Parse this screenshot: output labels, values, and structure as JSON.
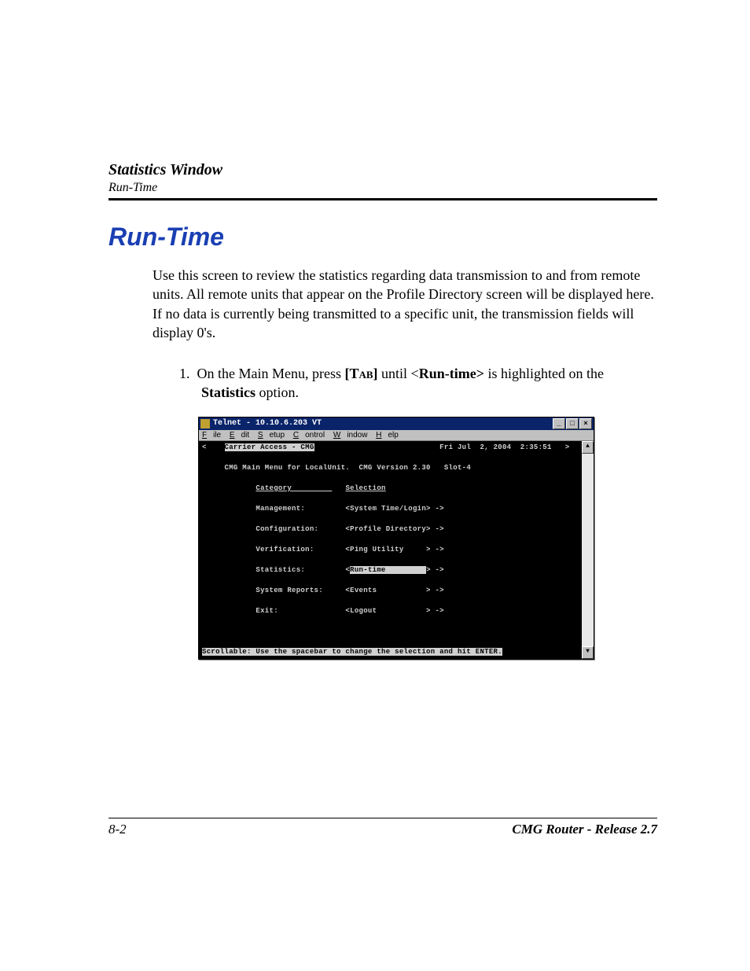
{
  "header": {
    "section_title": "Statistics Window",
    "subtitle": "Run-Time"
  },
  "main_heading": "Run-Time",
  "intro_paragraph": "Use this screen to review the statistics regarding data transmission to and from remote units. All remote units that appear on the Profile Directory screen will be displayed here. If no data is currently being transmitted to a specific unit, the transmission fields will display 0's.",
  "step": {
    "number": "1.",
    "pre": "On the Main Menu, press ",
    "tab": "[Tab]",
    "mid": " until <",
    "runtime": "Run-time>",
    "post1": " is highlighted on the ",
    "stats": "Statistics",
    "post2": " option."
  },
  "telnet": {
    "title": "Telnet - 10.10.6.203 VT",
    "menubar": {
      "file": "File",
      "edit": "Edit",
      "setup": "Setup",
      "control": "Control",
      "window": "Window",
      "help": "Help"
    },
    "top_left_inv": "Carrier Access - CMG",
    "top_date": "Fri Jul  2, 2004  2:35:51",
    "subheader": "CMG Main Menu for LocalUnit.  CMG Version 2.30   Slot-4",
    "col_category": "Category",
    "col_selection": "Selection",
    "rows": [
      {
        "cat": "Management:",
        "sel": "<System Time/Login> ->"
      },
      {
        "cat": "Configuration:",
        "sel": "<Profile Directory> ->"
      },
      {
        "cat": "Verification:",
        "sel": "<Ping Utility     > ->"
      },
      {
        "cat": "Statistics:",
        "sel_pre": "<",
        "sel_inv": "Run-time         ",
        "sel_post": "> ->"
      },
      {
        "cat": "System Reports:",
        "sel": "<Events           > ->"
      },
      {
        "cat": "Exit:",
        "sel": "<Logout           > ->"
      }
    ],
    "footer_hint": "Scrollable: Use the spacebar to change the selection and hit ENTER.",
    "scroll_up": "▲",
    "scroll_down": "▼",
    "btn_min": "_",
    "btn_max": "□",
    "btn_close": "×"
  },
  "footer": {
    "page": "8-2",
    "doc": "CMG Router - Release 2.7"
  }
}
